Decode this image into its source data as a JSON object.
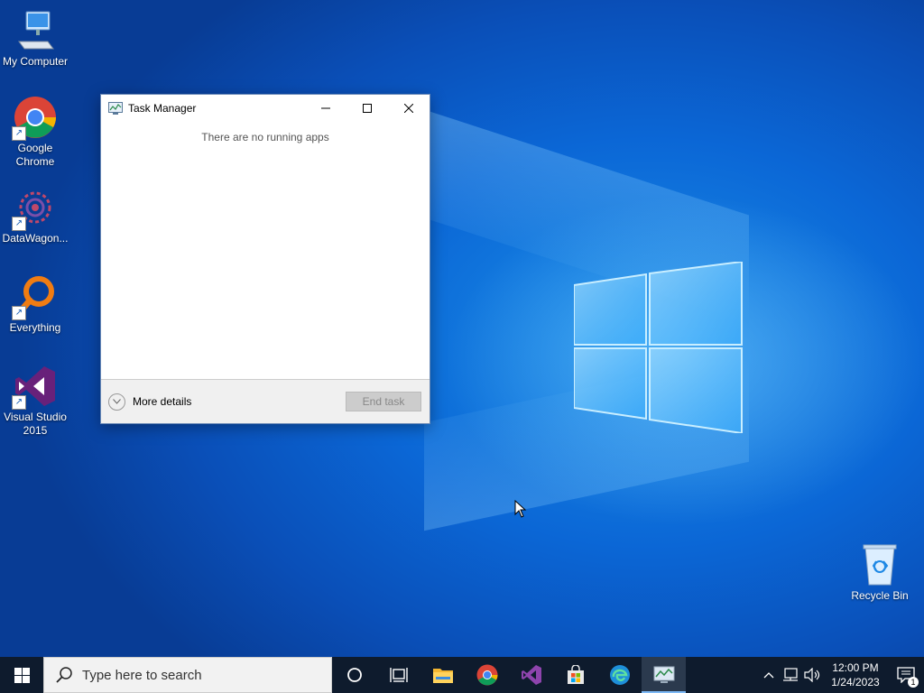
{
  "desktop": {
    "icons": [
      {
        "label": "My Computer",
        "icon": "computer-icon"
      },
      {
        "label": "Google Chrome",
        "icon": "chrome-icon"
      },
      {
        "label": "DataWagon...",
        "icon": "datawagon-icon"
      },
      {
        "label": "Everything",
        "icon": "everything-icon"
      },
      {
        "label": "Visual Studio 2015",
        "icon": "visual-studio-icon"
      },
      {
        "label": "Recycle Bin",
        "icon": "recycle-bin-icon"
      }
    ]
  },
  "task_manager": {
    "title": "Task Manager",
    "message": "There are no running apps",
    "more_details": "More details",
    "end_task": "End task"
  },
  "taskbar": {
    "search_placeholder": "Type here to search",
    "time": "12:00 PM",
    "date": "1/24/2023",
    "notification_count": "1"
  },
  "colors": {
    "taskbar": "#0e1b2d",
    "desktop_accent": "#0b67d6"
  }
}
